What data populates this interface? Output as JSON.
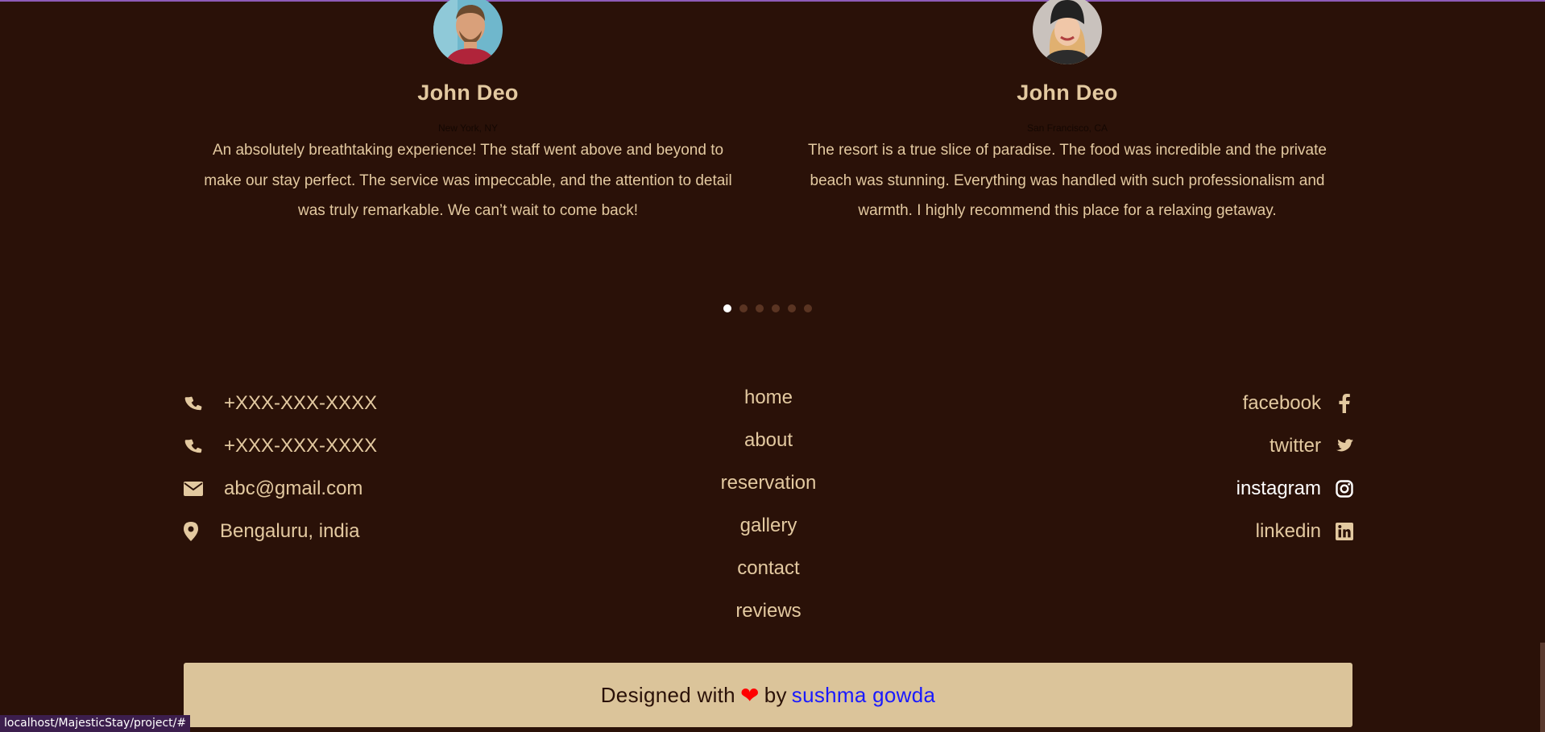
{
  "colors": {
    "background": "#2a1108",
    "accent_text": "#e3c9a0",
    "credit_bar": "#dbc49a",
    "heart": "#ff0000",
    "author_link": "#1a1aff",
    "top_border": "#8e5bb8"
  },
  "reviews": [
    {
      "name": "John Deo",
      "location": "New York, NY",
      "text": "An absolutely breathtaking experience! The staff went above and beyond to make our stay perfect. The service was impeccable, and the attention to detail was truly remarkable. We can’t wait to come back!",
      "avatar": "man-avatar-icon"
    },
    {
      "name": "John Deo",
      "location": "San Francisco, CA",
      "text": "The resort is a true slice of paradise. The food was incredible and the private beach was stunning. Everything was handled with such professionalism and warmth. I highly recommend this place for a relaxing getaway.",
      "avatar": "woman-avatar-icon"
    }
  ],
  "carousel": {
    "slide_count": 6,
    "active_index": 0
  },
  "contact": [
    {
      "icon": "phone-icon",
      "text": "+XXX-XXX-XXXX"
    },
    {
      "icon": "phone-icon",
      "text": "+XXX-XXX-XXXX"
    },
    {
      "icon": "envelope-icon",
      "text": "abc@gmail.com"
    },
    {
      "icon": "map-marker-icon",
      "text": "Bengaluru, india"
    }
  ],
  "links": [
    "home",
    "about",
    "reservation",
    "gallery",
    "contact",
    "reviews"
  ],
  "social": [
    {
      "label": "facebook",
      "icon": "facebook-icon"
    },
    {
      "label": "twitter",
      "icon": "twitter-icon"
    },
    {
      "label": "instagram",
      "icon": "instagram-icon"
    },
    {
      "label": "linkedin",
      "icon": "linkedin-icon"
    }
  ],
  "credit": {
    "prefix": "Designed with",
    "heart": "❤",
    "by": "by",
    "author": "sushma gowda"
  },
  "status_url": "localhost/MajesticStay/project/#"
}
